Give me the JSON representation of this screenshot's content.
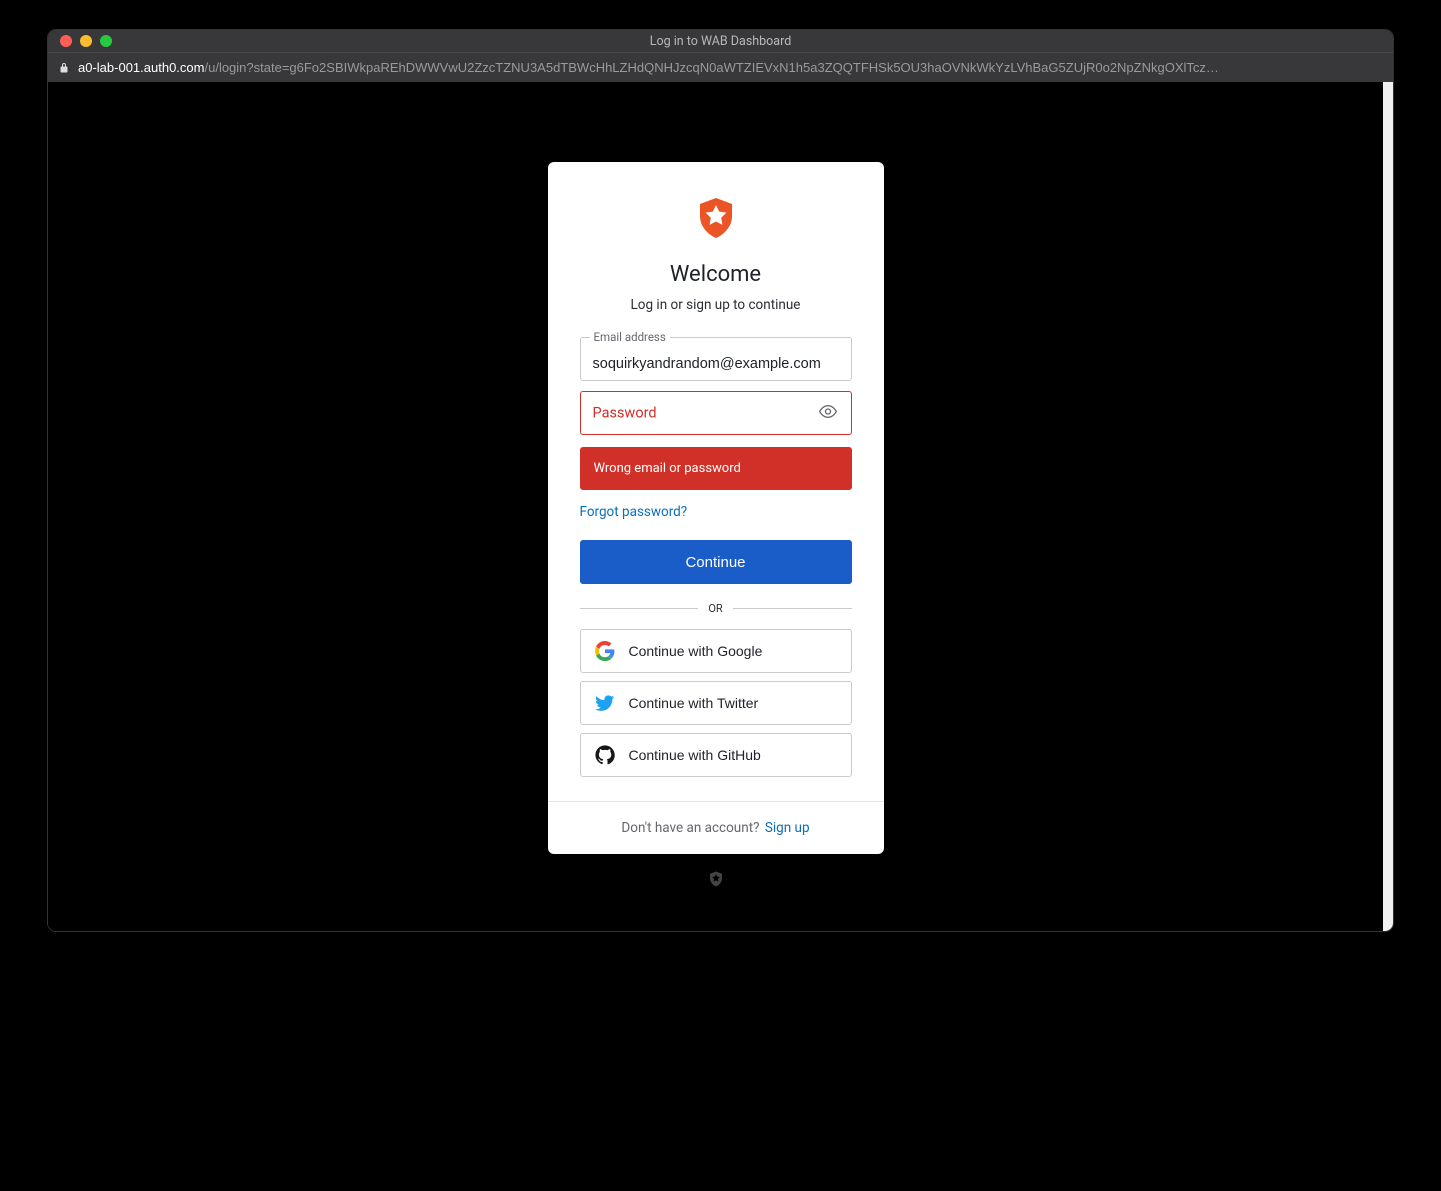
{
  "window": {
    "title": "Log in to WAB Dashboard"
  },
  "address": {
    "host": "a0-lab-001.auth0.com",
    "path": "/u/login?state=g6Fo2SBIWkpaREhDWWVwU2ZzcTZNU3A5dTBWcHhLZHdQNHJzcqN0aWTZIEVxN1h5a3ZQQTFHSk5OU3haOVNkWkYzLVhBaG5ZUjR0o2NpZNkgOXlTcz…"
  },
  "card": {
    "title": "Welcome",
    "subtitle": "Log in or sign up to continue",
    "email_label": "Email address",
    "email_value": "soquirkyandrandom@example.com",
    "password_label": "Password",
    "error_message": "Wrong email or password",
    "forgot_label": "Forgot password?",
    "continue_label": "Continue",
    "divider_label": "OR",
    "social": {
      "google": "Continue with Google",
      "twitter": "Continue with Twitter",
      "github": "Continue with GitHub"
    },
    "footer_prompt": "Don't have an account?",
    "signup_label": "Sign up"
  },
  "colors": {
    "accent": "#1a5cc8",
    "error": "#d03027",
    "brand": "#eb5424"
  }
}
